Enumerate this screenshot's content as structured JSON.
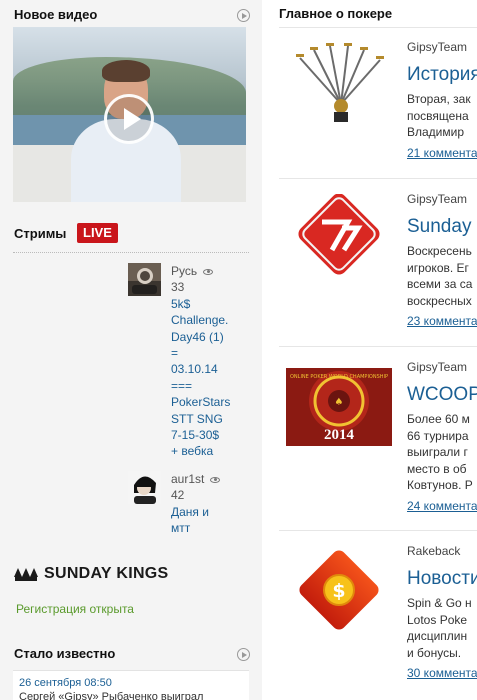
{
  "left": {
    "new_video": {
      "title": "Новое видео"
    },
    "streams": {
      "title": "Стримы",
      "live_badge": "LIVE",
      "items": [
        {
          "name": "Русь",
          "views": "33",
          "title_lines": [
            "5k$",
            "Challenge.",
            "Day46 (1)",
            "=",
            "03.10.14",
            "===",
            "PokerStars",
            "STT SNG",
            "7-15-30$",
            "+ вебка"
          ]
        },
        {
          "name": "aur1st",
          "views": "42",
          "title_lines": [
            "Даня и",
            "мтт"
          ]
        }
      ]
    },
    "sunday_kings": {
      "logo_text": "SUNDAY KINGS",
      "registration_link": "Регистрация открыта"
    },
    "became_known": {
      "title": "Стало известно",
      "items": [
        {
          "date": "26 сентября 08:50",
          "text": "Сергей «Gipsy» Рыбаченко выиграл"
        }
      ]
    }
  },
  "right": {
    "title": "Главное о покере",
    "articles": [
      {
        "author": "GipsyTeam",
        "headline": "История",
        "excerpt": [
          "Вторая, зак",
          "посвящена",
          "Владимир"
        ],
        "comments": "21 коммента"
      },
      {
        "author": "GipsyTeam",
        "headline": "Sunday",
        "excerpt": [
          "Воскресень",
          "игроков. Ег",
          "всеми за са",
          "воскресных"
        ],
        "comments": "23 коммента"
      },
      {
        "author": "GipsyTeam",
        "headline": "WCOOP",
        "excerpt": [
          "Более 60 м",
          "66 турнира",
          "выиграли г",
          "место в об",
          "Ковтунов. Р"
        ],
        "comments": "24 коммента"
      },
      {
        "author": "Rakeback",
        "headline": "Новости",
        "excerpt": [
          "Spin & Go н",
          "Lotos Poke",
          "дисциплин",
          "и бонусы."
        ],
        "comments": "30 коммента"
      }
    ],
    "badge_2014": "2014",
    "badge_ring_text": "ONLINE POKER WORLD CHAMPIONSHIP"
  }
}
